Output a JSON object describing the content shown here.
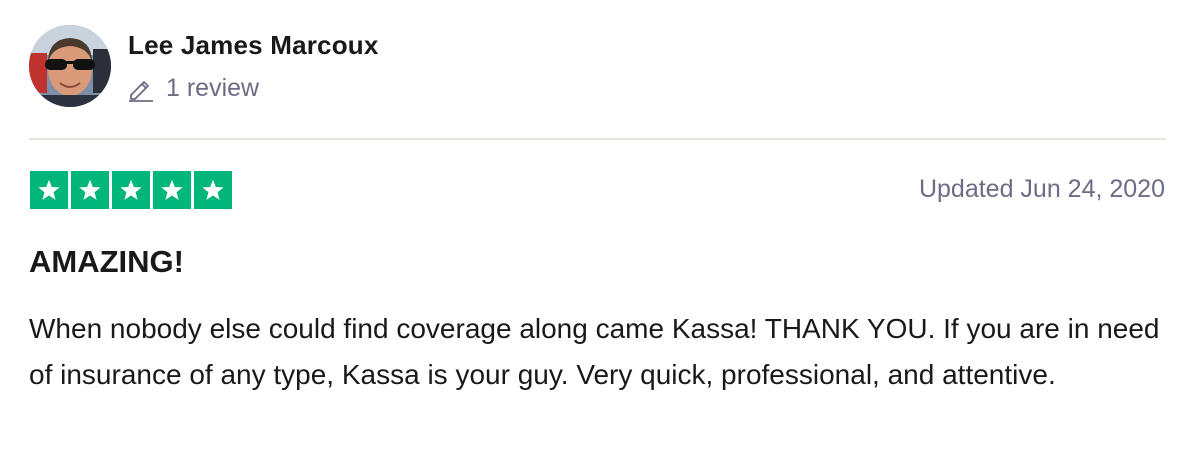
{
  "reviewer": {
    "name": "Lee James Marcoux",
    "review_count": "1 review",
    "avatar_icon": "avatar-photo-icon"
  },
  "review": {
    "rating": 5,
    "rating_max": 5,
    "star_color": "#00b67a",
    "date": "Updated Jun 24, 2020",
    "title": "AMAZING!",
    "body": "When nobody else could find coverage along came Kassa! THANK YOU. If you are in need of insurance of any type, Kassa is your guy. Very quick, professional, and attentive."
  },
  "icons": {
    "review_count": "pencil-icon",
    "star": "star-icon"
  },
  "colors": {
    "text_primary": "#191919",
    "text_secondary": "#6c6c85",
    "divider": "#e5e5dd"
  }
}
